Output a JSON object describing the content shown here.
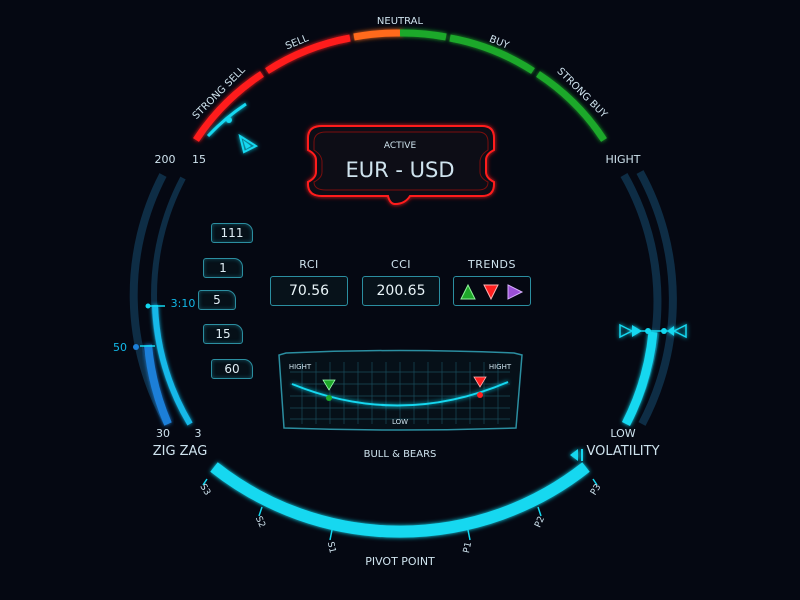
{
  "colors": {
    "cyan": "#12d8f0",
    "blue": "#1c7fd8",
    "red": "#ff1f1f",
    "orange": "#ff6a1a",
    "green": "#1fa82a",
    "panel": "#061018"
  },
  "sentiment_gauge": {
    "labels": [
      "STRONG SELL",
      "SELL",
      "NEUTRAL",
      "BUY",
      "STRONG BUY"
    ]
  },
  "active": {
    "label": "ACTIVE",
    "pair": "EUR - USD"
  },
  "zigzag": {
    "title": "ZIG ZAG",
    "top_left": "200",
    "top_right": "15",
    "bottom_left": "30",
    "bottom_right": "3",
    "marker_a": "3:10",
    "marker_b": "50"
  },
  "timeframes": [
    "111",
    "1",
    "5",
    "15",
    "60"
  ],
  "indicators": {
    "rci": {
      "label": "RCI",
      "value": "70.56"
    },
    "cci": {
      "label": "CCI",
      "value": "200.65"
    },
    "trends": {
      "label": "TRENDS",
      "icons": [
        "trend-up-icon",
        "trend-down-icon",
        "trend-right-icon"
      ]
    }
  },
  "bulls_bears": {
    "title": "BULL & BEARS",
    "hight_left": "HIGHT",
    "hight_right": "HIGHT",
    "low": "LOW"
  },
  "volatility": {
    "title": "VOLATILITY",
    "top": "HIGHT",
    "bottom": "LOW"
  },
  "pivot": {
    "title": "PIVOT POINT",
    "ticks": [
      "S3",
      "S2",
      "S1",
      "P1",
      "P2",
      "P3"
    ]
  }
}
